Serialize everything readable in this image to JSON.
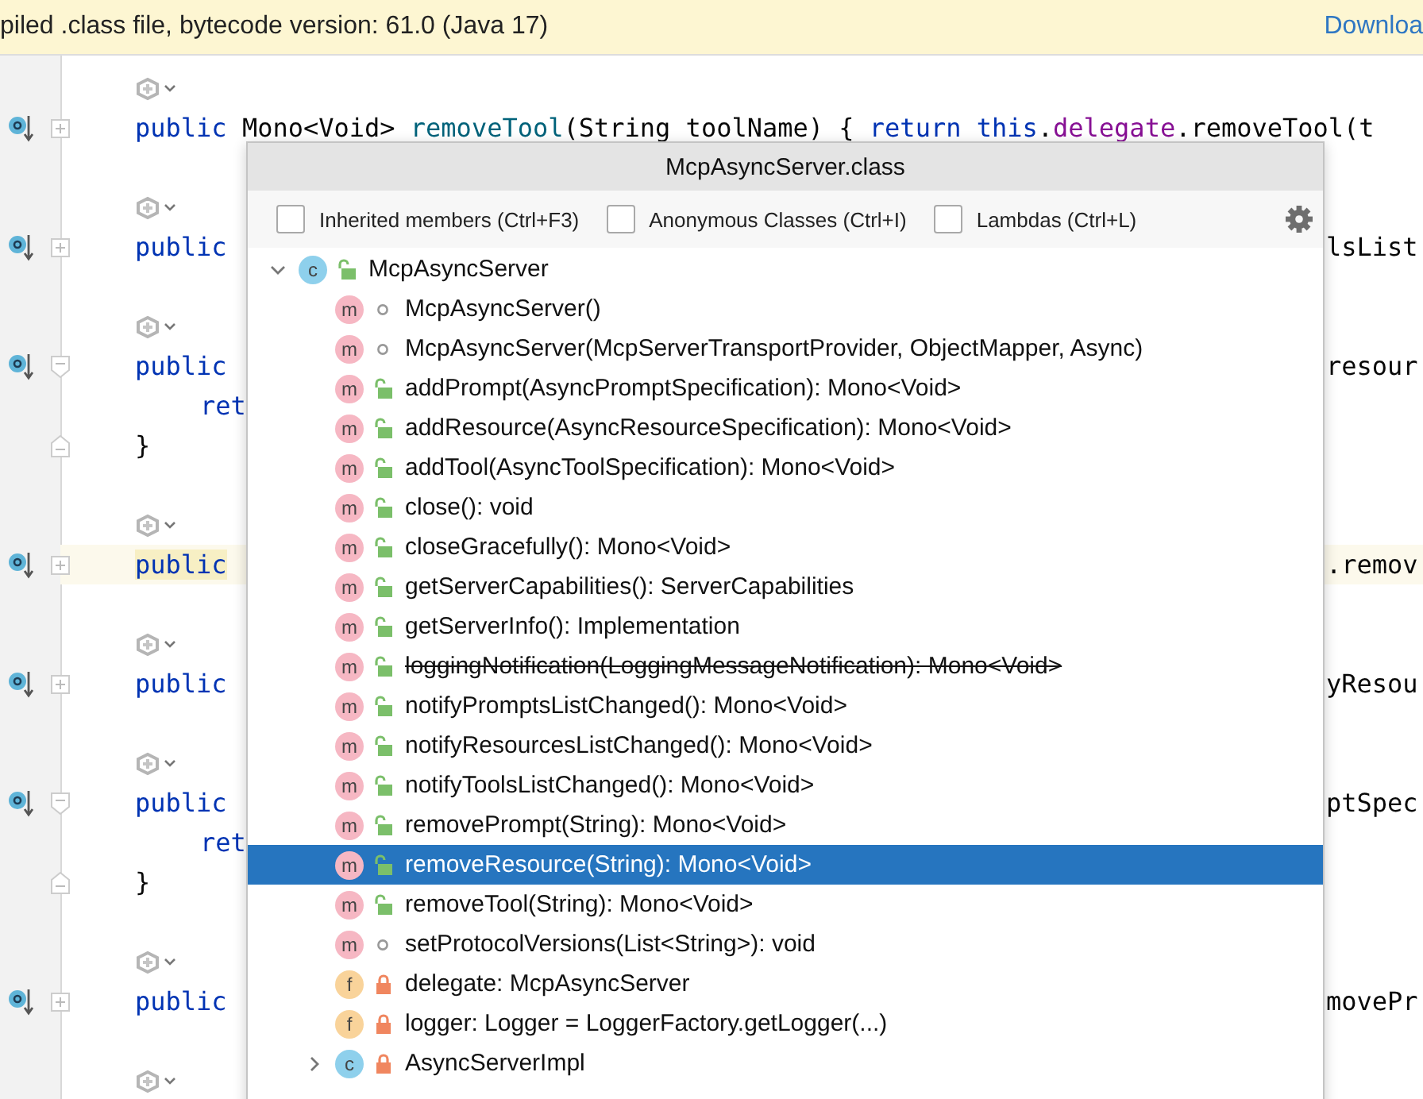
{
  "banner": {
    "text": "piled .class file, bytecode version: 61.0 (Java 17)",
    "link": "Downloa"
  },
  "editor": {
    "lines": [
      {
        "kind": "hint"
      },
      {
        "kind": "code",
        "overridden": true,
        "fold_collapsed": true,
        "fold_start": false,
        "fold_end": false,
        "highlighted": false,
        "indented": false,
        "segments": [
          {
            "text": "public ",
            "kind": "keyword"
          },
          {
            "text": "Mono<Void> ",
            "kind": "plain"
          },
          {
            "text": "removeTool",
            "kind": "method"
          },
          {
            "text": "(",
            "kind": "plain"
          },
          {
            "text": "String",
            "kind": "plain"
          },
          {
            "text": " toolName) ",
            "kind": "plain"
          },
          {
            "text": "{",
            "kind": "plain"
          },
          {
            "text": " return this",
            "kind": "keyword"
          },
          {
            "text": ".",
            "kind": "plain"
          },
          {
            "text": "delegate",
            "kind": "field"
          },
          {
            "text": ".removeTool(t",
            "kind": "plain"
          }
        ]
      },
      {
        "kind": "blank"
      },
      {
        "kind": "hint"
      },
      {
        "kind": "code",
        "overridden": true,
        "fold_collapsed": true,
        "fold_start": false,
        "fold_end": false,
        "highlighted": false,
        "indented": false,
        "segments": [
          {
            "text": "public",
            "kind": "keyword"
          }
        ],
        "right": "lsList"
      },
      {
        "kind": "blank"
      },
      {
        "kind": "hint"
      },
      {
        "kind": "code",
        "overridden": true,
        "fold_collapsed": false,
        "fold_start": true,
        "fold_end": false,
        "highlighted": false,
        "indented": false,
        "segments": [
          {
            "text": "public",
            "kind": "keyword"
          }
        ],
        "right": "resour"
      },
      {
        "kind": "code",
        "overridden": false,
        "fold_collapsed": false,
        "fold_start": false,
        "fold_end": false,
        "highlighted": false,
        "indented": true,
        "segments": [
          {
            "text": "ret",
            "kind": "keyword"
          }
        ]
      },
      {
        "kind": "code",
        "overridden": false,
        "fold_collapsed": false,
        "fold_start": false,
        "fold_end": true,
        "highlighted": false,
        "indented": false,
        "segments": [
          {
            "text": "}",
            "kind": "plain"
          }
        ]
      },
      {
        "kind": "blank"
      },
      {
        "kind": "hint"
      },
      {
        "kind": "code",
        "overridden": true,
        "fold_collapsed": true,
        "fold_start": false,
        "fold_end": false,
        "highlighted": true,
        "indented": false,
        "segments": [
          {
            "text": "public",
            "kind": "keyword"
          }
        ],
        "right": ".remov"
      },
      {
        "kind": "blank"
      },
      {
        "kind": "hint"
      },
      {
        "kind": "code",
        "overridden": true,
        "fold_collapsed": true,
        "fold_start": false,
        "fold_end": false,
        "highlighted": false,
        "indented": false,
        "segments": [
          {
            "text": "public",
            "kind": "keyword"
          }
        ],
        "right": "yResou"
      },
      {
        "kind": "blank"
      },
      {
        "kind": "hint"
      },
      {
        "kind": "code",
        "overridden": true,
        "fold_collapsed": false,
        "fold_start": true,
        "fold_end": false,
        "highlighted": false,
        "indented": false,
        "segments": [
          {
            "text": "public",
            "kind": "keyword"
          }
        ],
        "right": "ptSpec"
      },
      {
        "kind": "code",
        "overridden": false,
        "fold_collapsed": false,
        "fold_start": false,
        "fold_end": false,
        "highlighted": false,
        "indented": true,
        "segments": [
          {
            "text": "ret",
            "kind": "keyword"
          }
        ]
      },
      {
        "kind": "code",
        "overridden": false,
        "fold_collapsed": false,
        "fold_start": false,
        "fold_end": true,
        "highlighted": false,
        "indented": false,
        "segments": [
          {
            "text": "}",
            "kind": "plain"
          }
        ]
      },
      {
        "kind": "blank"
      },
      {
        "kind": "hint"
      },
      {
        "kind": "code",
        "overridden": true,
        "fold_collapsed": true,
        "fold_start": false,
        "fold_end": false,
        "highlighted": false,
        "indented": false,
        "segments": [
          {
            "text": "public",
            "kind": "keyword"
          }
        ],
        "right": "movePr"
      },
      {
        "kind": "blank"
      },
      {
        "kind": "hint"
      }
    ]
  },
  "popup": {
    "title": "McpAsyncServer.class",
    "options": [
      {
        "label": "Inherited members (Ctrl+F3)",
        "checked": false
      },
      {
        "label": "Anonymous Classes (Ctrl+I)",
        "checked": false
      },
      {
        "label": "Lambdas (Ctrl+L)",
        "checked": false
      }
    ],
    "tree": [
      {
        "name": "McpAsyncServer",
        "kind": "class",
        "badge": "c",
        "private": false,
        "package_private": false,
        "deprecated": false,
        "selected": false,
        "expanded": true,
        "children": [
          {
            "name": "McpAsyncServer()",
            "kind": "method",
            "badge": "m",
            "private": false,
            "package_private": true,
            "deprecated": false,
            "selected": false
          },
          {
            "name": "McpAsyncServer(McpServerTransportProvider, ObjectMapper, Async)",
            "kind": "method",
            "badge": "m",
            "private": false,
            "package_private": true,
            "deprecated": false,
            "selected": false
          },
          {
            "name": "addPrompt(AsyncPromptSpecification): Mono<Void>",
            "kind": "method",
            "badge": "m",
            "private": false,
            "package_private": false,
            "deprecated": false,
            "selected": false
          },
          {
            "name": "addResource(AsyncResourceSpecification): Mono<Void>",
            "kind": "method",
            "badge": "m",
            "private": false,
            "package_private": false,
            "deprecated": false,
            "selected": false
          },
          {
            "name": "addTool(AsyncToolSpecification): Mono<Void>",
            "kind": "method",
            "badge": "m",
            "private": false,
            "package_private": false,
            "deprecated": false,
            "selected": false
          },
          {
            "name": "close(): void",
            "kind": "method",
            "badge": "m",
            "private": false,
            "package_private": false,
            "deprecated": false,
            "selected": false
          },
          {
            "name": "closeGracefully(): Mono<Void>",
            "kind": "method",
            "badge": "m",
            "private": false,
            "package_private": false,
            "deprecated": false,
            "selected": false
          },
          {
            "name": "getServerCapabilities(): ServerCapabilities",
            "kind": "method",
            "badge": "m",
            "private": false,
            "package_private": false,
            "deprecated": false,
            "selected": false
          },
          {
            "name": "getServerInfo(): Implementation",
            "kind": "method",
            "badge": "m",
            "private": false,
            "package_private": false,
            "deprecated": false,
            "selected": false
          },
          {
            "name": "loggingNotification(LoggingMessageNotification): Mono<Void>",
            "kind": "method",
            "badge": "m",
            "private": false,
            "package_private": false,
            "deprecated": true,
            "selected": false
          },
          {
            "name": "notifyPromptsListChanged(): Mono<Void>",
            "kind": "method",
            "badge": "m",
            "private": false,
            "package_private": false,
            "deprecated": false,
            "selected": false
          },
          {
            "name": "notifyResourcesListChanged(): Mono<Void>",
            "kind": "method",
            "badge": "m",
            "private": false,
            "package_private": false,
            "deprecated": false,
            "selected": false
          },
          {
            "name": "notifyToolsListChanged(): Mono<Void>",
            "kind": "method",
            "badge": "m",
            "private": false,
            "package_private": false,
            "deprecated": false,
            "selected": false
          },
          {
            "name": "removePrompt(String): Mono<Void>",
            "kind": "method",
            "badge": "m",
            "private": false,
            "package_private": false,
            "deprecated": false,
            "selected": false
          },
          {
            "name": "removeResource(String): Mono<Void>",
            "kind": "method",
            "badge": "m",
            "private": false,
            "package_private": false,
            "deprecated": false,
            "selected": true
          },
          {
            "name": "removeTool(String): Mono<Void>",
            "kind": "method",
            "badge": "m",
            "private": false,
            "package_private": false,
            "deprecated": false,
            "selected": false
          },
          {
            "name": "setProtocolVersions(List<String>): void",
            "kind": "method",
            "badge": "m",
            "private": false,
            "package_private": true,
            "deprecated": false,
            "selected": false
          },
          {
            "name": "delegate: McpAsyncServer",
            "kind": "field",
            "badge": "f",
            "private": true,
            "package_private": false,
            "deprecated": false,
            "selected": false
          },
          {
            "name": "logger: Logger = LoggerFactory.getLogger(...)",
            "kind": "field",
            "badge": "f",
            "private": true,
            "package_private": false,
            "deprecated": false,
            "selected": false
          },
          {
            "name": "AsyncServerImpl",
            "kind": "class",
            "badge": "c",
            "private": true,
            "package_private": false,
            "deprecated": false,
            "selected": false,
            "expanded": false
          }
        ]
      }
    ]
  }
}
